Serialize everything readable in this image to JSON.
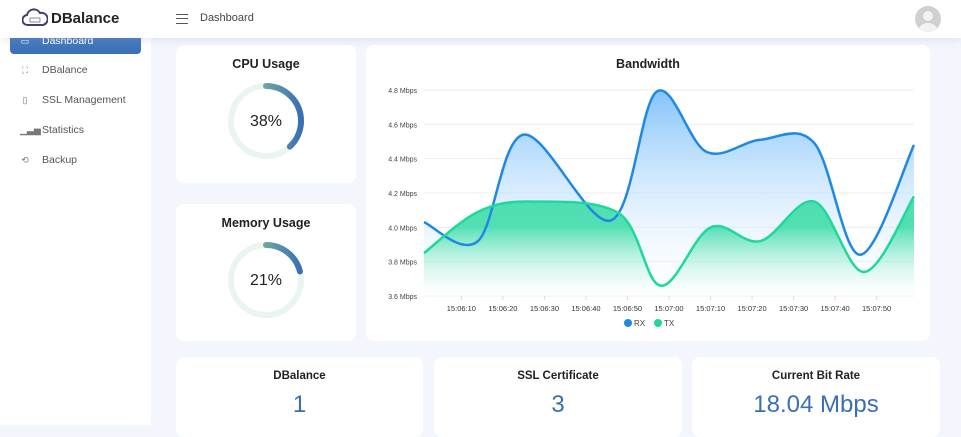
{
  "header": {
    "brand": "DBalance",
    "breadcrumb": "Dashboard"
  },
  "sidebar": {
    "items": [
      {
        "label": "Dashboard",
        "icon": "monitor-icon",
        "active": true
      },
      {
        "label": "DBalance",
        "icon": "expand-icon"
      },
      {
        "label": "SSL Management",
        "icon": "file-icon"
      },
      {
        "label": "Statistics",
        "icon": "bar-chart-icon"
      },
      {
        "label": "Backup",
        "icon": "history-icon"
      }
    ]
  },
  "cpu": {
    "title": "CPU Usage",
    "value": "38%",
    "percent": 38
  },
  "memory": {
    "title": "Memory Usage",
    "value": "21%",
    "percent": 21
  },
  "stats": [
    {
      "title": "DBalance",
      "value": "1"
    },
    {
      "title": "SSL Certificate",
      "value": "3"
    },
    {
      "title": "Current Bit Rate",
      "value": "18.04 Mbps"
    }
  ],
  "colors": {
    "accent": "#3a6fb5",
    "rx": "#1e88e5",
    "tx": "#1ed99a",
    "background": "#f3f6fd"
  },
  "chart_data": {
    "type": "area",
    "title": "Bandwidth",
    "ylim": [
      3.6,
      4.8
    ],
    "yticks": [
      "3.6 Mbps",
      "3.8 Mbps",
      "4.0 Mbps",
      "4.2 Mbps",
      "4.4 Mbps",
      "4.6 Mbps",
      "4.8 Mbps"
    ],
    "xticks": [
      "15:06:10",
      "15:06:20",
      "15:06:30",
      "15:06:40",
      "15:06:50",
      "15:07:00",
      "15:07:10",
      "15:07:20",
      "15:07:30",
      "15:07:40",
      "15:07:50"
    ],
    "xlim": [
      "15:06:01",
      "15:07:59"
    ],
    "grid": true,
    "legend": "bottom",
    "series": [
      {
        "name": "RX",
        "x": [
          "15:06:01",
          "15:06:14",
          "15:06:25",
          "15:06:46",
          "15:06:57",
          "15:07:09",
          "15:07:22",
          "15:07:35",
          "15:07:46",
          "15:07:59"
        ],
        "values": [
          4.03,
          3.92,
          4.54,
          4.04,
          4.79,
          4.44,
          4.51,
          4.49,
          3.84,
          4.48
        ]
      },
      {
        "name": "TX",
        "x": [
          "15:06:01",
          "15:06:14",
          "15:06:27",
          "15:06:48",
          "15:06:58",
          "15:07:10",
          "15:07:22",
          "15:07:35",
          "15:07:47",
          "15:07:59"
        ],
        "values": [
          3.85,
          4.09,
          4.15,
          4.08,
          3.66,
          4.0,
          3.92,
          4.15,
          3.74,
          4.18
        ]
      }
    ]
  }
}
